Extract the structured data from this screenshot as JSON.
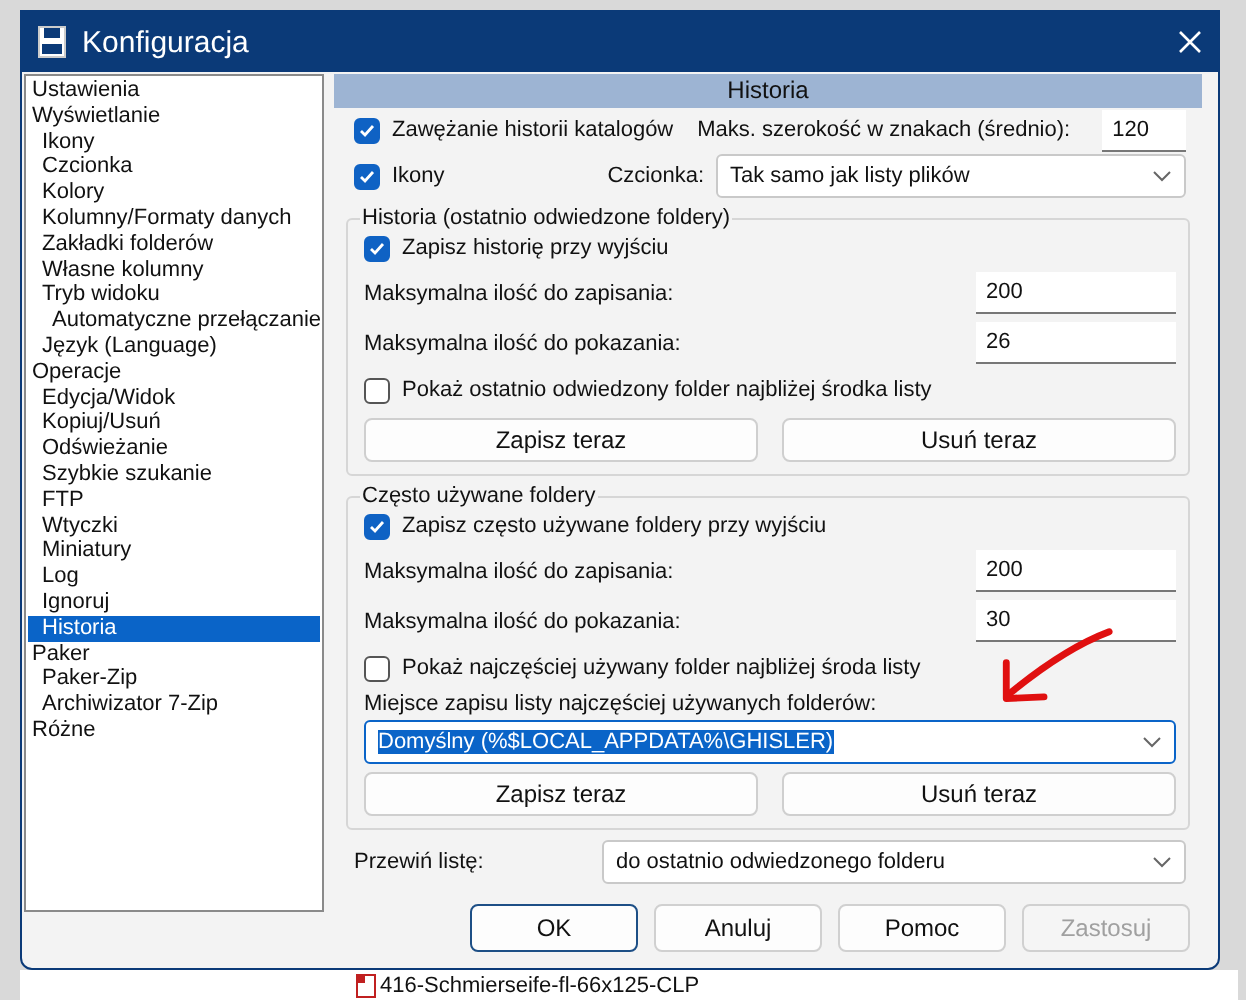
{
  "window": {
    "title": "Konfiguracja"
  },
  "sidebar": {
    "items": [
      {
        "label": "Ustawienia",
        "selected": false
      },
      {
        "label": "Wyświetlanie",
        "selected": false,
        "children": [
          {
            "label": "Ikony",
            "selected": false
          },
          {
            "label": "Czcionka",
            "selected": false
          },
          {
            "label": "Kolory",
            "selected": false
          },
          {
            "label": "Kolumny/Formaty danych",
            "selected": false
          },
          {
            "label": "Zakładki folderów",
            "selected": false
          },
          {
            "label": "Własne kolumny",
            "selected": false
          },
          {
            "label": "Tryb widoku",
            "selected": false,
            "children": [
              {
                "label": "Automatyczne przełączanie",
                "selected": false
              }
            ]
          },
          {
            "label": "Język (Language)",
            "selected": false
          }
        ]
      },
      {
        "label": "Operacje",
        "selected": false,
        "children": [
          {
            "label": "Edycja/Widok",
            "selected": false
          },
          {
            "label": "Kopiuj/Usuń",
            "selected": false
          },
          {
            "label": "Odświeżanie",
            "selected": false
          },
          {
            "label": "Szybkie szukanie",
            "selected": false
          },
          {
            "label": "FTP",
            "selected": false
          },
          {
            "label": "Wtyczki",
            "selected": false
          },
          {
            "label": "Miniatury",
            "selected": false
          },
          {
            "label": "Log",
            "selected": false
          },
          {
            "label": "Ignoruj",
            "selected": false
          },
          {
            "label": "Historia",
            "selected": true
          }
        ]
      },
      {
        "label": "Paker",
        "selected": false,
        "children": [
          {
            "label": "Paker-Zip",
            "selected": false
          },
          {
            "label": "Archiwizator 7-Zip",
            "selected": false
          }
        ]
      },
      {
        "label": "Różne",
        "selected": false
      }
    ]
  },
  "panel": {
    "header": "Historia",
    "narrow_history": {
      "label": "Zawężanie historii katalogów",
      "checked": true
    },
    "max_width": {
      "label": "Maks. szerokość w znakach (średnio):",
      "value": "120"
    },
    "icons": {
      "label": "Ikony",
      "checked": true
    },
    "font": {
      "label": "Czcionka:",
      "value": "Tak samo jak listy plików"
    },
    "groups": [
      {
        "title": "Historia (ostatnio odwiedzone foldery)",
        "save_on_exit": {
          "label": "Zapisz historię przy wyjściu",
          "checked": true
        },
        "fields": [
          {
            "label": "Maksymalna ilość do zapisania:",
            "value": "200"
          },
          {
            "label": "Maksymalna ilość do pokazania:",
            "value": "26"
          }
        ],
        "show_middle": {
          "label": "Pokaż ostatnio odwiedzony folder najbliżej środka listy",
          "checked": false
        },
        "buttons": [
          "Zapisz teraz",
          "Usuń teraz"
        ]
      },
      {
        "title": "Często używane foldery",
        "save_on_exit": {
          "label": "Zapisz często używane foldery przy wyjściu",
          "checked": true
        },
        "fields": [
          {
            "label": "Maksymalna ilość do zapisania:",
            "value": "200"
          },
          {
            "label": "Maksymalna ilość do pokazania:",
            "value": "30"
          }
        ],
        "show_middle": {
          "label": "Pokaż najczęściej używany folder najbliżej środa listy",
          "checked": false
        },
        "location": {
          "label": "Miejsce zapisu listy najczęściej używanych folderów:",
          "value": "Domyślny (%$LOCAL_APPDATA%\\GHISLER)",
          "highlighted": true
        },
        "buttons": [
          "Zapisz teraz",
          "Usuń teraz"
        ]
      }
    ],
    "scroll": {
      "label": "Przewiń listę:",
      "value": "do ostatnio odwiedzonego folderu"
    }
  },
  "buttons": [
    {
      "label": "OK",
      "default": true,
      "disabled": false
    },
    {
      "label": "Anuluj",
      "default": false,
      "disabled": false
    },
    {
      "label": "Pomoc",
      "default": false,
      "disabled": false
    },
    {
      "label": "Zastosuj",
      "default": false,
      "disabled": true
    }
  ],
  "background_file": {
    "name": "416-Schmierseife-fl-66x125-CLP"
  }
}
